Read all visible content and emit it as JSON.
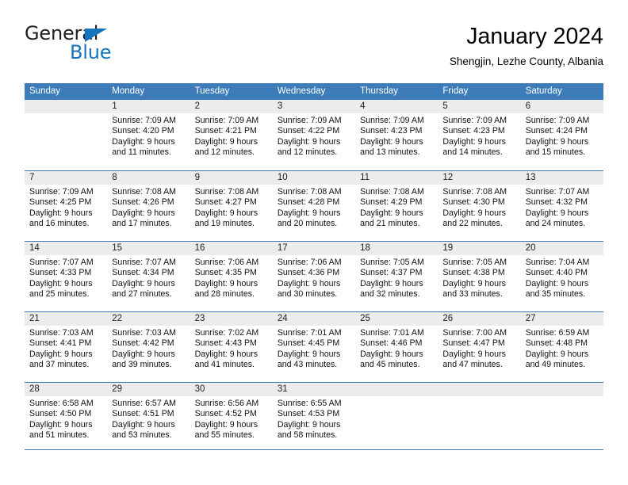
{
  "brand": {
    "name_part1": "General",
    "name_part2": "Blue",
    "accent_color": "#1574bb"
  },
  "header": {
    "title": "January 2024",
    "subtitle": "Shengjin, Lezhe County, Albania"
  },
  "theme": {
    "header_row_bg": "#3d7cb8",
    "daynum_band_bg": "#ececec",
    "grid_line": "#3d7cb8"
  },
  "weekdays": [
    "Sunday",
    "Monday",
    "Tuesday",
    "Wednesday",
    "Thursday",
    "Friday",
    "Saturday"
  ],
  "weeks": [
    [
      {
        "day": "",
        "sunrise": "",
        "sunset": "",
        "daylight1": "",
        "daylight2": ""
      },
      {
        "day": "1",
        "sunrise": "Sunrise: 7:09 AM",
        "sunset": "Sunset: 4:20 PM",
        "daylight1": "Daylight: 9 hours",
        "daylight2": "and 11 minutes."
      },
      {
        "day": "2",
        "sunrise": "Sunrise: 7:09 AM",
        "sunset": "Sunset: 4:21 PM",
        "daylight1": "Daylight: 9 hours",
        "daylight2": "and 12 minutes."
      },
      {
        "day": "3",
        "sunrise": "Sunrise: 7:09 AM",
        "sunset": "Sunset: 4:22 PM",
        "daylight1": "Daylight: 9 hours",
        "daylight2": "and 12 minutes."
      },
      {
        "day": "4",
        "sunrise": "Sunrise: 7:09 AM",
        "sunset": "Sunset: 4:23 PM",
        "daylight1": "Daylight: 9 hours",
        "daylight2": "and 13 minutes."
      },
      {
        "day": "5",
        "sunrise": "Sunrise: 7:09 AM",
        "sunset": "Sunset: 4:23 PM",
        "daylight1": "Daylight: 9 hours",
        "daylight2": "and 14 minutes."
      },
      {
        "day": "6",
        "sunrise": "Sunrise: 7:09 AM",
        "sunset": "Sunset: 4:24 PM",
        "daylight1": "Daylight: 9 hours",
        "daylight2": "and 15 minutes."
      }
    ],
    [
      {
        "day": "7",
        "sunrise": "Sunrise: 7:09 AM",
        "sunset": "Sunset: 4:25 PM",
        "daylight1": "Daylight: 9 hours",
        "daylight2": "and 16 minutes."
      },
      {
        "day": "8",
        "sunrise": "Sunrise: 7:08 AM",
        "sunset": "Sunset: 4:26 PM",
        "daylight1": "Daylight: 9 hours",
        "daylight2": "and 17 minutes."
      },
      {
        "day": "9",
        "sunrise": "Sunrise: 7:08 AM",
        "sunset": "Sunset: 4:27 PM",
        "daylight1": "Daylight: 9 hours",
        "daylight2": "and 19 minutes."
      },
      {
        "day": "10",
        "sunrise": "Sunrise: 7:08 AM",
        "sunset": "Sunset: 4:28 PM",
        "daylight1": "Daylight: 9 hours",
        "daylight2": "and 20 minutes."
      },
      {
        "day": "11",
        "sunrise": "Sunrise: 7:08 AM",
        "sunset": "Sunset: 4:29 PM",
        "daylight1": "Daylight: 9 hours",
        "daylight2": "and 21 minutes."
      },
      {
        "day": "12",
        "sunrise": "Sunrise: 7:08 AM",
        "sunset": "Sunset: 4:30 PM",
        "daylight1": "Daylight: 9 hours",
        "daylight2": "and 22 minutes."
      },
      {
        "day": "13",
        "sunrise": "Sunrise: 7:07 AM",
        "sunset": "Sunset: 4:32 PM",
        "daylight1": "Daylight: 9 hours",
        "daylight2": "and 24 minutes."
      }
    ],
    [
      {
        "day": "14",
        "sunrise": "Sunrise: 7:07 AM",
        "sunset": "Sunset: 4:33 PM",
        "daylight1": "Daylight: 9 hours",
        "daylight2": "and 25 minutes."
      },
      {
        "day": "15",
        "sunrise": "Sunrise: 7:07 AM",
        "sunset": "Sunset: 4:34 PM",
        "daylight1": "Daylight: 9 hours",
        "daylight2": "and 27 minutes."
      },
      {
        "day": "16",
        "sunrise": "Sunrise: 7:06 AM",
        "sunset": "Sunset: 4:35 PM",
        "daylight1": "Daylight: 9 hours",
        "daylight2": "and 28 minutes."
      },
      {
        "day": "17",
        "sunrise": "Sunrise: 7:06 AM",
        "sunset": "Sunset: 4:36 PM",
        "daylight1": "Daylight: 9 hours",
        "daylight2": "and 30 minutes."
      },
      {
        "day": "18",
        "sunrise": "Sunrise: 7:05 AM",
        "sunset": "Sunset: 4:37 PM",
        "daylight1": "Daylight: 9 hours",
        "daylight2": "and 32 minutes."
      },
      {
        "day": "19",
        "sunrise": "Sunrise: 7:05 AM",
        "sunset": "Sunset: 4:38 PM",
        "daylight1": "Daylight: 9 hours",
        "daylight2": "and 33 minutes."
      },
      {
        "day": "20",
        "sunrise": "Sunrise: 7:04 AM",
        "sunset": "Sunset: 4:40 PM",
        "daylight1": "Daylight: 9 hours",
        "daylight2": "and 35 minutes."
      }
    ],
    [
      {
        "day": "21",
        "sunrise": "Sunrise: 7:03 AM",
        "sunset": "Sunset: 4:41 PM",
        "daylight1": "Daylight: 9 hours",
        "daylight2": "and 37 minutes."
      },
      {
        "day": "22",
        "sunrise": "Sunrise: 7:03 AM",
        "sunset": "Sunset: 4:42 PM",
        "daylight1": "Daylight: 9 hours",
        "daylight2": "and 39 minutes."
      },
      {
        "day": "23",
        "sunrise": "Sunrise: 7:02 AM",
        "sunset": "Sunset: 4:43 PM",
        "daylight1": "Daylight: 9 hours",
        "daylight2": "and 41 minutes."
      },
      {
        "day": "24",
        "sunrise": "Sunrise: 7:01 AM",
        "sunset": "Sunset: 4:45 PM",
        "daylight1": "Daylight: 9 hours",
        "daylight2": "and 43 minutes."
      },
      {
        "day": "25",
        "sunrise": "Sunrise: 7:01 AM",
        "sunset": "Sunset: 4:46 PM",
        "daylight1": "Daylight: 9 hours",
        "daylight2": "and 45 minutes."
      },
      {
        "day": "26",
        "sunrise": "Sunrise: 7:00 AM",
        "sunset": "Sunset: 4:47 PM",
        "daylight1": "Daylight: 9 hours",
        "daylight2": "and 47 minutes."
      },
      {
        "day": "27",
        "sunrise": "Sunrise: 6:59 AM",
        "sunset": "Sunset: 4:48 PM",
        "daylight1": "Daylight: 9 hours",
        "daylight2": "and 49 minutes."
      }
    ],
    [
      {
        "day": "28",
        "sunrise": "Sunrise: 6:58 AM",
        "sunset": "Sunset: 4:50 PM",
        "daylight1": "Daylight: 9 hours",
        "daylight2": "and 51 minutes."
      },
      {
        "day": "29",
        "sunrise": "Sunrise: 6:57 AM",
        "sunset": "Sunset: 4:51 PM",
        "daylight1": "Daylight: 9 hours",
        "daylight2": "and 53 minutes."
      },
      {
        "day": "30",
        "sunrise": "Sunrise: 6:56 AM",
        "sunset": "Sunset: 4:52 PM",
        "daylight1": "Daylight: 9 hours",
        "daylight2": "and 55 minutes."
      },
      {
        "day": "31",
        "sunrise": "Sunrise: 6:55 AM",
        "sunset": "Sunset: 4:53 PM",
        "daylight1": "Daylight: 9 hours",
        "daylight2": "and 58 minutes."
      },
      {
        "day": "",
        "sunrise": "",
        "sunset": "",
        "daylight1": "",
        "daylight2": ""
      },
      {
        "day": "",
        "sunrise": "",
        "sunset": "",
        "daylight1": "",
        "daylight2": ""
      },
      {
        "day": "",
        "sunrise": "",
        "sunset": "",
        "daylight1": "",
        "daylight2": ""
      }
    ]
  ]
}
